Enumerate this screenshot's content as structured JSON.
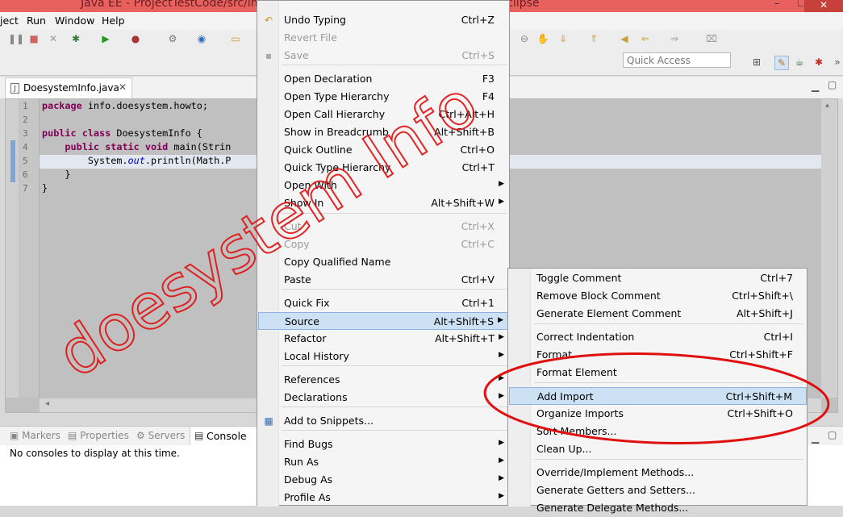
{
  "window": {
    "title": "Java EE - ProjectTestCode/src/info/doesystem/howto/DoesystemInfo.java - Eclipse"
  },
  "menubar": {
    "items": [
      "ject",
      "Run",
      "Window",
      "Help"
    ]
  },
  "toolbar": {
    "quick_access_placeholder": "Quick Access"
  },
  "editor": {
    "tab_label": "DoesystemInfo.java",
    "line_numbers": [
      "1",
      "2",
      "3",
      "4",
      "5",
      "6",
      "7"
    ],
    "code": {
      "l1_kw": "package",
      "l1_rest": " info.doesystem.howto;",
      "l3_kw": "public class",
      "l3_rest": " DoesystemInfo {",
      "l4_indent": "    ",
      "l4_kw": "public static void",
      "l4_rest": " main(Strin",
      "l5_pre": "        System.",
      "l5_field": "out",
      "l5_rest": ".println(Math.P",
      "l6": "    }",
      "l7": "}"
    }
  },
  "bottom_panel": {
    "tabs": [
      "Markers",
      "Properties",
      "Servers",
      "Console"
    ],
    "console_message": "No consoles to display at this time."
  },
  "context_menu": {
    "items": [
      {
        "label": "Undo Typing",
        "shortcut": "Ctrl+Z",
        "icon": "undo-icon"
      },
      {
        "label": "Revert File",
        "shortcut": "",
        "disabled": true
      },
      {
        "label": "Save",
        "shortcut": "Ctrl+S",
        "disabled": true,
        "icon": "save-icon"
      },
      {
        "label": "Open Declaration",
        "shortcut": "F3"
      },
      {
        "label": "Open Type Hierarchy",
        "shortcut": "F4"
      },
      {
        "label": "Open Call Hierarchy",
        "shortcut": "Ctrl+Alt+H"
      },
      {
        "label": "Show in Breadcrumb",
        "shortcut": "Alt+Shift+B"
      },
      {
        "label": "Quick Outline",
        "shortcut": "Ctrl+O"
      },
      {
        "label": "Quick Type Hierarchy",
        "shortcut": "Ctrl+T"
      },
      {
        "label": "Open With",
        "shortcut": "",
        "submenu": true
      },
      {
        "label": "Show In",
        "shortcut": "Alt+Shift+W",
        "submenu": true
      },
      {
        "label": "Cut",
        "shortcut": "Ctrl+X",
        "disabled": true
      },
      {
        "label": "Copy",
        "shortcut": "Ctrl+C",
        "disabled": true
      },
      {
        "label": "Copy Qualified Name",
        "shortcut": ""
      },
      {
        "label": "Paste",
        "shortcut": "Ctrl+V"
      },
      {
        "label": "Quick Fix",
        "shortcut": "Ctrl+1"
      },
      {
        "label": "Source",
        "shortcut": "Alt+Shift+S",
        "submenu": true,
        "active": true
      },
      {
        "label": "Refactor",
        "shortcut": "Alt+Shift+T",
        "submenu": true
      },
      {
        "label": "Local History",
        "shortcut": "",
        "submenu": true
      },
      {
        "label": "References",
        "shortcut": "",
        "submenu": true
      },
      {
        "label": "Declarations",
        "shortcut": "",
        "submenu": true
      },
      {
        "label": "Add to Snippets...",
        "shortcut": "",
        "icon": "snippet-icon"
      },
      {
        "label": "Find Bugs",
        "shortcut": "",
        "submenu": true
      },
      {
        "label": "Run As",
        "shortcut": "",
        "submenu": true
      },
      {
        "label": "Debug As",
        "shortcut": "",
        "submenu": true
      },
      {
        "label": "Profile As",
        "shortcut": "",
        "submenu": true
      }
    ]
  },
  "source_submenu": {
    "items": [
      {
        "label": "Toggle Comment",
        "shortcut": "Ctrl+7"
      },
      {
        "label": "Remove Block Comment",
        "shortcut": "Ctrl+Shift+\\"
      },
      {
        "label": "Generate Element Comment",
        "shortcut": "Alt+Shift+J"
      },
      {
        "label": "Correct Indentation",
        "shortcut": "Ctrl+I"
      },
      {
        "label": "Format",
        "shortcut": "Ctrl+Shift+F"
      },
      {
        "label": "Format Element",
        "shortcut": ""
      },
      {
        "label": "Add Import",
        "shortcut": "Ctrl+Shift+M",
        "active": true
      },
      {
        "label": "Organize Imports",
        "shortcut": "Ctrl+Shift+O"
      },
      {
        "label": "Sort Members...",
        "shortcut": ""
      },
      {
        "label": "Clean Up...",
        "shortcut": ""
      },
      {
        "label": "Override/Implement Methods...",
        "shortcut": ""
      },
      {
        "label": "Generate Getters and Setters...",
        "shortcut": ""
      },
      {
        "label": "Generate Delegate Methods...",
        "shortcut": ""
      }
    ]
  },
  "annotation": {
    "watermark": "doesystem Info",
    "ink_color": "#e01010"
  }
}
